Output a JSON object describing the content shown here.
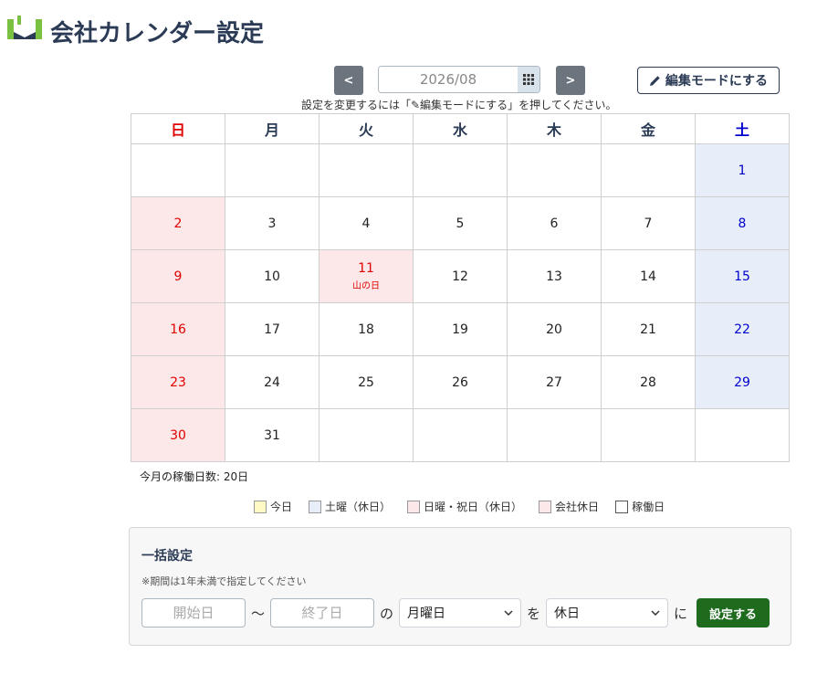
{
  "header": {
    "title": "会社カレンダー設定",
    "logo_colors": {
      "green": "#7ac142",
      "navy": "#2b3b55"
    }
  },
  "toolbar": {
    "prev_label": "<",
    "next_label": ">",
    "month_value": "2026/08",
    "edit_label": "編集モードにする",
    "edit_hint": "設定を変更するには「✎編集モードにする」を押してください。"
  },
  "calendar": {
    "weekdays": [
      "日",
      "月",
      "火",
      "水",
      "木",
      "金",
      "土"
    ],
    "weeks": [
      [
        {
          "d": ""
        },
        {
          "d": ""
        },
        {
          "d": ""
        },
        {
          "d": ""
        },
        {
          "d": ""
        },
        {
          "d": ""
        },
        {
          "d": "1",
          "t": "sat"
        }
      ],
      [
        {
          "d": "2",
          "t": "sun"
        },
        {
          "d": "3"
        },
        {
          "d": "4"
        },
        {
          "d": "5"
        },
        {
          "d": "6"
        },
        {
          "d": "7"
        },
        {
          "d": "8",
          "t": "sat"
        }
      ],
      [
        {
          "d": "9",
          "t": "sun"
        },
        {
          "d": "10"
        },
        {
          "d": "11",
          "t": "hol",
          "h": "山の日"
        },
        {
          "d": "12"
        },
        {
          "d": "13"
        },
        {
          "d": "14"
        },
        {
          "d": "15",
          "t": "sat"
        }
      ],
      [
        {
          "d": "16",
          "t": "sun"
        },
        {
          "d": "17"
        },
        {
          "d": "18"
        },
        {
          "d": "19"
        },
        {
          "d": "20"
        },
        {
          "d": "21"
        },
        {
          "d": "22",
          "t": "sat"
        }
      ],
      [
        {
          "d": "23",
          "t": "sun"
        },
        {
          "d": "24"
        },
        {
          "d": "25"
        },
        {
          "d": "26"
        },
        {
          "d": "27"
        },
        {
          "d": "28"
        },
        {
          "d": "29",
          "t": "sat"
        }
      ],
      [
        {
          "d": "30",
          "t": "sun"
        },
        {
          "d": "31"
        },
        {
          "d": ""
        },
        {
          "d": ""
        },
        {
          "d": ""
        },
        {
          "d": ""
        },
        {
          "d": ""
        }
      ]
    ],
    "colors": {
      "sunday": "#e00000",
      "saturday": "#0000cc",
      "holiday_bg": "#fce8e8",
      "saturday_bg": "#e8eef9"
    }
  },
  "summary": {
    "workdays_text": "今月の稼働日数: 20日"
  },
  "legend": [
    {
      "label": "今日",
      "color": "#fff9c4"
    },
    {
      "label": "土曜（休日）",
      "color": "#e8eef9"
    },
    {
      "label": "日曜・祝日（休日）",
      "color": "#fce8e8"
    },
    {
      "label": "会社休日",
      "color": "#fce8e8"
    },
    {
      "label": "稼働日",
      "color": "#ffffff"
    }
  ],
  "bulk": {
    "title": "一括設定",
    "note": "※期間は1年未満で指定してください",
    "start_placeholder": "開始日",
    "tilde": "〜",
    "end_placeholder": "終了日",
    "no": "の",
    "weekday_value": "月曜日",
    "wo": "を",
    "type_value": "休日",
    "ni": "に",
    "submit_label": "設定する",
    "submit_color": "#1e6b1e"
  }
}
